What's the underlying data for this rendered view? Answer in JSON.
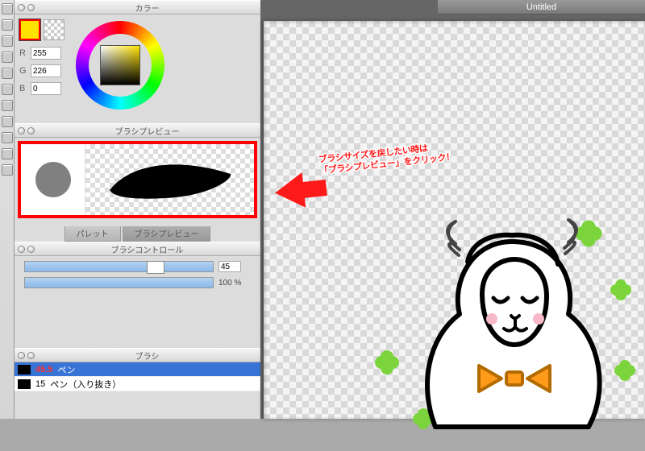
{
  "panels": {
    "color": {
      "title": "カラー",
      "r": "255",
      "g": "226",
      "b": "0",
      "labels": {
        "r": "R",
        "g": "G",
        "b": "B"
      }
    },
    "brush_preview": {
      "title": "ブラシプレビュー",
      "tab_palette": "パレット",
      "tab_preview": "ブラシプレビュー"
    },
    "brush_control": {
      "title": "ブラシコントロール",
      "size": "45",
      "opacity": "100 %"
    },
    "brush_list": {
      "title": "ブラシ",
      "items": [
        {
          "size": "45.5",
          "name": "ペン",
          "selected": true
        },
        {
          "size": "15",
          "name": "ペン（入り抜き）",
          "selected": false
        }
      ]
    }
  },
  "canvas": {
    "tab_title": "Untitled"
  },
  "callout": {
    "line1": "ブラシサイズを戻したい時は",
    "line2": "「ブラシプレビュー」をクリック！"
  },
  "colors": {
    "accent": "#ffe200",
    "highlight": "#ff0000"
  }
}
